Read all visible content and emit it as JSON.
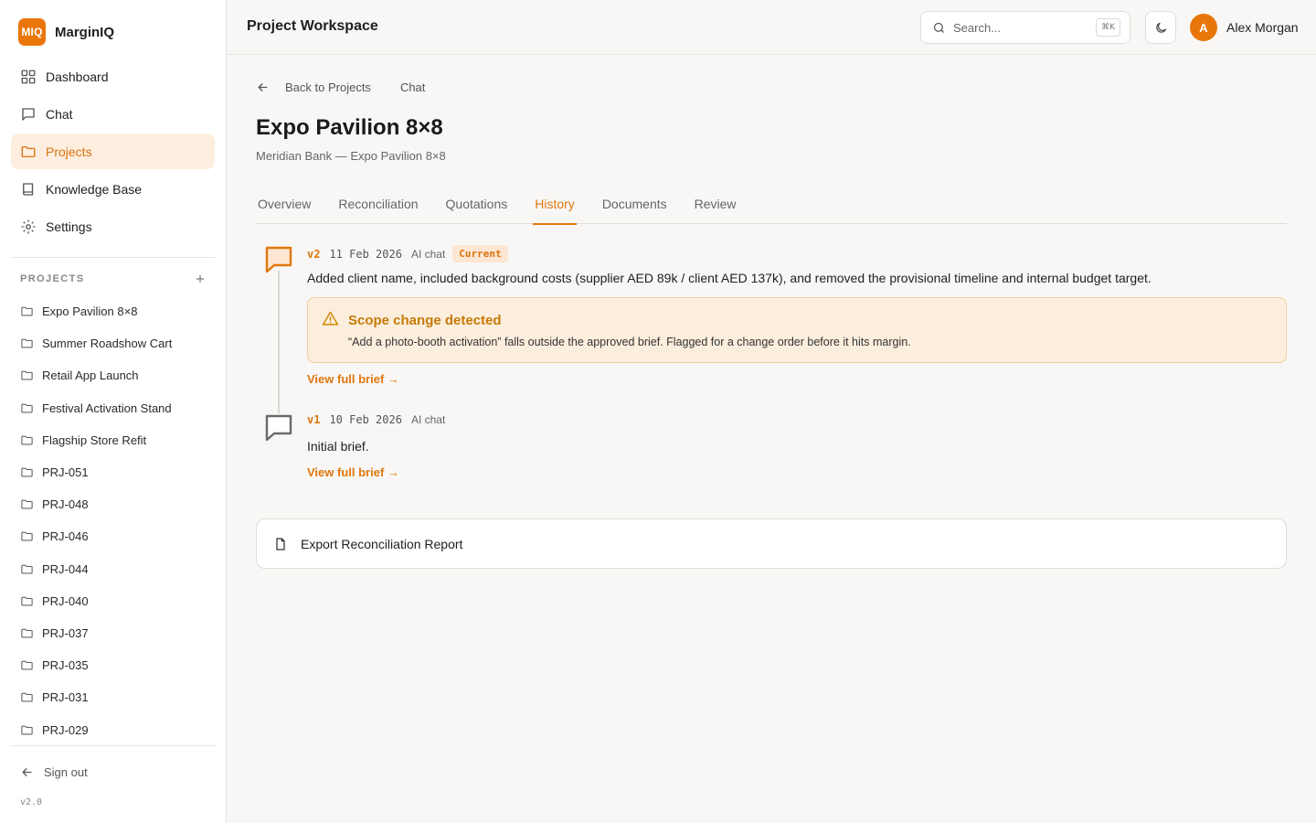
{
  "brand": {
    "logo_text": "MIQ",
    "name": "MarginIQ",
    "accent": "#e8760a"
  },
  "nav": [
    {
      "label": "Dashboard",
      "icon": "grid-icon",
      "active": false
    },
    {
      "label": "Chat",
      "icon": "message-icon",
      "active": false
    },
    {
      "label": "Projects",
      "icon": "folder-icon",
      "active": true
    },
    {
      "label": "Knowledge Base",
      "icon": "book-icon",
      "active": false
    },
    {
      "label": "Settings",
      "icon": "gear-icon",
      "active": false
    }
  ],
  "projects_section": {
    "label": "PROJECTS",
    "items": [
      "Expo Pavilion 8×8",
      "Summer Roadshow Cart",
      "Retail App Launch",
      "Festival Activation Stand",
      "Flagship Store Refit",
      "PRJ-051",
      "PRJ-048",
      "PRJ-046",
      "PRJ-044",
      "PRJ-040",
      "PRJ-037",
      "PRJ-035",
      "PRJ-031",
      "PRJ-029"
    ]
  },
  "sidebar_footer": {
    "signout_label": "Sign out",
    "version": "v2.0"
  },
  "header": {
    "title": "Project Workspace",
    "search_placeholder": "Search...",
    "search_shortcut": "⌘K",
    "user_initial": "A",
    "user_name": "Alex Morgan"
  },
  "breadcrumb": {
    "back_label": "Back to Projects",
    "current": "Chat"
  },
  "project": {
    "title": "Expo Pavilion 8×8",
    "subtitle": "Meridian Bank — Expo Pavilion 8×8"
  },
  "tabs": [
    {
      "label": "Overview",
      "active": false
    },
    {
      "label": "Reconciliation",
      "active": false
    },
    {
      "label": "Quotations",
      "active": false
    },
    {
      "label": "History",
      "active": true
    },
    {
      "label": "Documents",
      "active": false
    },
    {
      "label": "Review",
      "active": false
    }
  ],
  "history": [
    {
      "version": "v2",
      "date": "11 Feb 2026",
      "source": "AI chat",
      "badge": "Current",
      "text": "Added client name, included background costs (supplier AED 89k / client AED 137k), and removed the provisional timeline and internal budget target.",
      "alert": {
        "title": "Scope change detected",
        "text": "“Add a photo-booth activation” falls outside the approved brief. Flagged for a change order before it hits margin."
      },
      "link": "View full brief →"
    },
    {
      "version": "v1",
      "date": "10 Feb 2026",
      "source": "AI chat",
      "text": "Initial brief.",
      "link": "View full brief →"
    }
  ],
  "export": {
    "label": "Export Reconciliation Report"
  },
  "colors": {
    "accent": "#e0760d",
    "alert_bg": "#fceedd",
    "alert_border": "#f3cf9f",
    "alert_title": "#c67a07"
  }
}
